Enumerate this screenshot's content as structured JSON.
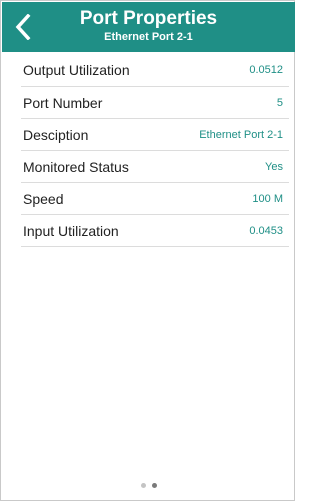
{
  "header": {
    "title": "Port Properties",
    "subtitle": "Ethernet Port 2-1",
    "back_icon": "chevron-left-icon",
    "color": "#1f8f86"
  },
  "properties": [
    {
      "label": "Output Utilization",
      "value": "0.0512"
    },
    {
      "label": "Port Number",
      "value": "5"
    },
    {
      "label": "Desciption",
      "value": "Ethernet Port 2-1"
    },
    {
      "label": "Monitored Status",
      "value": "Yes"
    },
    {
      "label": "Speed",
      "value": "100 M"
    },
    {
      "label": "Input Utilization",
      "value": "0.0453"
    }
  ],
  "pager": {
    "total_pages": 2,
    "active_page": 2
  },
  "colors": {
    "accent": "#1f8f86",
    "label": "#222222",
    "divider": "#dcdcdc"
  }
}
